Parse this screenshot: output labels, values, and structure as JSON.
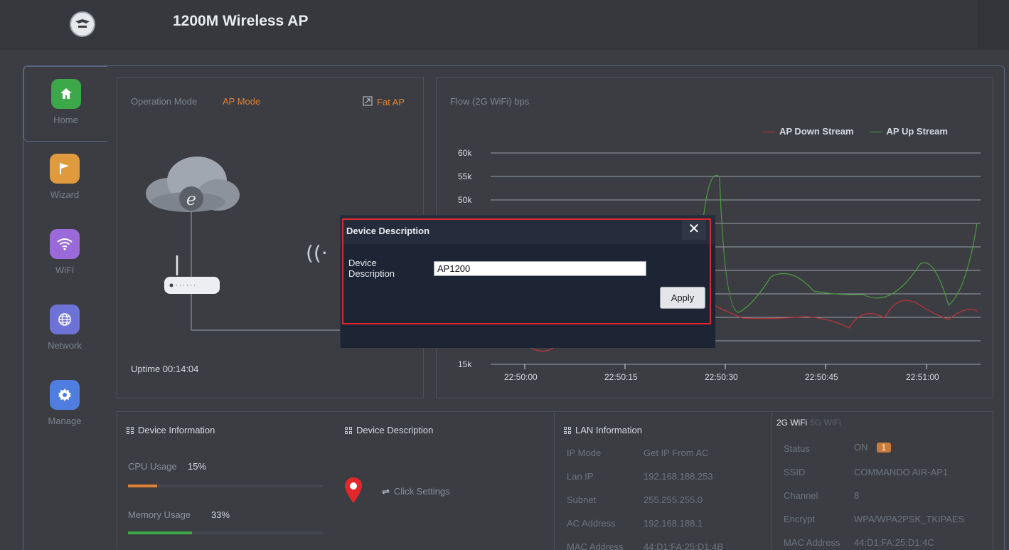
{
  "header": {
    "title": "1200M Wireless AP",
    "logo_icon": "commando-logo-icon"
  },
  "sidebar": {
    "items": [
      {
        "label": "Home",
        "icon": "home-icon",
        "color": "#3ca84a",
        "active": true
      },
      {
        "label": "Wizard",
        "icon": "flag-icon",
        "color": "#e09a3e",
        "active": false
      },
      {
        "label": "WiFi",
        "icon": "wifi-icon",
        "color": "#9a6ad8",
        "active": false
      },
      {
        "label": "Network",
        "icon": "globe-icon",
        "color": "#6d72d6",
        "active": false
      },
      {
        "label": "Manage",
        "icon": "gear-icon",
        "color": "#4f7ee0",
        "active": false
      }
    ]
  },
  "mode_panel": {
    "label": "Operation Mode",
    "value": "AP Mode",
    "fat_ap": "Fat AP",
    "uptime": "Uptime 00:14:04"
  },
  "flow_panel": {
    "title": "Flow (2G WiFi) bps",
    "legend_down": "AP Down Stream",
    "legend_up": "AP Up Stream"
  },
  "chart_data": {
    "type": "line",
    "x": [
      "22:50:00",
      "22:50:15",
      "22:50:30",
      "22:50:45",
      "22:51:00"
    ],
    "y_ticks": [
      "60k",
      "55k",
      "50k",
      "15k"
    ],
    "ylim": [
      15000,
      60000
    ],
    "series": [
      {
        "name": "AP Down Stream",
        "color": "#c0343a"
      },
      {
        "name": "AP Up Stream",
        "color": "#4e9a43"
      }
    ]
  },
  "device_info": {
    "title": "Device Information",
    "cpu_label": "CPU Usage",
    "cpu_value": "15%",
    "cpu_fraction": 0.15,
    "mem_label": "Memory Usage",
    "mem_value": "33%",
    "mem_fraction": 0.33
  },
  "device_description": {
    "title": "Device Description",
    "action": "Click Settings"
  },
  "lan": {
    "title": "LAN Information",
    "rows": [
      {
        "k": "IP Mode",
        "v": "Get IP From AC"
      },
      {
        "k": "Lan IP",
        "v": "192.168.188.253"
      },
      {
        "k": "Subnet",
        "v": "255.255.255.0"
      },
      {
        "k": "AC Address",
        "v": "192.168.188.1"
      },
      {
        "k": "MAC Address",
        "v": "44:D1:FA:25:D1:4B"
      }
    ]
  },
  "wifi": {
    "tab_2g": "2G WiFi",
    "tab_5g": "5G WiFi",
    "status_label": "Status",
    "status_value": "ON",
    "status_badge": "1",
    "rows": [
      {
        "k": "SSID",
        "v": "COMMANDO AIR-AP1"
      },
      {
        "k": "Channel",
        "v": "8"
      },
      {
        "k": "Encrypt",
        "v": "WPA/WPA2PSK_TKIPAES"
      },
      {
        "k": "MAC Address",
        "v": "44:D1:FA:25:D1:4C"
      }
    ]
  },
  "modal": {
    "title": "Device Description",
    "field_label": "Device Description",
    "field_value": "AP1200",
    "apply": "Apply"
  }
}
